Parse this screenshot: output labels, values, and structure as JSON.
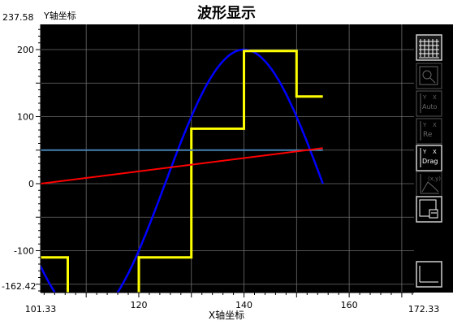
{
  "chart_data": {
    "type": "line",
    "title": "波形显示",
    "xlabel": "X轴坐标",
    "ylabel": "Y轴坐标",
    "xlim": [
      101.33,
      172.33
    ],
    "ylim": [
      -162.42,
      237.58
    ],
    "x_range_labels": [
      "101.33",
      "172.33"
    ],
    "y_range_labels": [
      "-162.42",
      "237.58"
    ],
    "x_ticks": [
      120,
      140,
      160
    ],
    "x_tick_labels": [
      "120",
      "140",
      "160"
    ],
    "y_ticks": [
      -100,
      0,
      100,
      200
    ],
    "y_tick_labels": [
      "-100",
      "0",
      "100",
      "200"
    ],
    "grid": true,
    "background": "#000000",
    "series": [
      {
        "color": "#0000ff",
        "kind": "sine",
        "x_start": 100,
        "x_end": 155,
        "amplitude": 200,
        "period": 60,
        "phase_x": 110,
        "peak_x": 140,
        "peak_y": 200
      },
      {
        "color": "#ffff00",
        "kind": "step",
        "x": [
          101.33,
          106.5,
          106.5,
          110,
          110,
          120,
          120,
          127.5,
          127.5,
          130,
          130,
          135,
          135,
          136,
          136,
          140,
          140,
          150,
          150,
          155
        ],
        "y": [
          -110,
          -110,
          -166,
          -166,
          -166,
          -166,
          -110,
          -110,
          -110,
          -110,
          82,
          82,
          82,
          82,
          82,
          82,
          198,
          198,
          130,
          130
        ]
      },
      {
        "color": "#4682b4",
        "kind": "constant",
        "x": [
          101.33,
          155
        ],
        "y": [
          50,
          50
        ]
      },
      {
        "color": "#ff0000",
        "kind": "line",
        "x": [
          101.33,
          155
        ],
        "y": [
          0,
          53
        ]
      }
    ]
  },
  "toolbar": {
    "buttons": [
      {
        "name": "grid-toggle-button",
        "icon": "grid-icon",
        "enabled": true
      },
      {
        "name": "zoom-button",
        "icon": "zoom-icon",
        "enabled": false
      },
      {
        "name": "auto-scale-button",
        "icon": "auto-scale-icon",
        "enabled": false,
        "label": "Auto"
      },
      {
        "name": "reset-button",
        "icon": "reset-icon",
        "enabled": false,
        "label": "Re"
      },
      {
        "name": "drag-button",
        "icon": "drag-icon",
        "enabled": true,
        "label": "Drag"
      },
      {
        "name": "xy-readout-button",
        "icon": "xy-readout-icon",
        "enabled": false,
        "label": "(x,y)"
      },
      {
        "name": "export-button",
        "icon": "export-icon",
        "enabled": true
      },
      {
        "name": "corner-button",
        "icon": "axis-corner-icon",
        "enabled": true
      }
    ]
  }
}
